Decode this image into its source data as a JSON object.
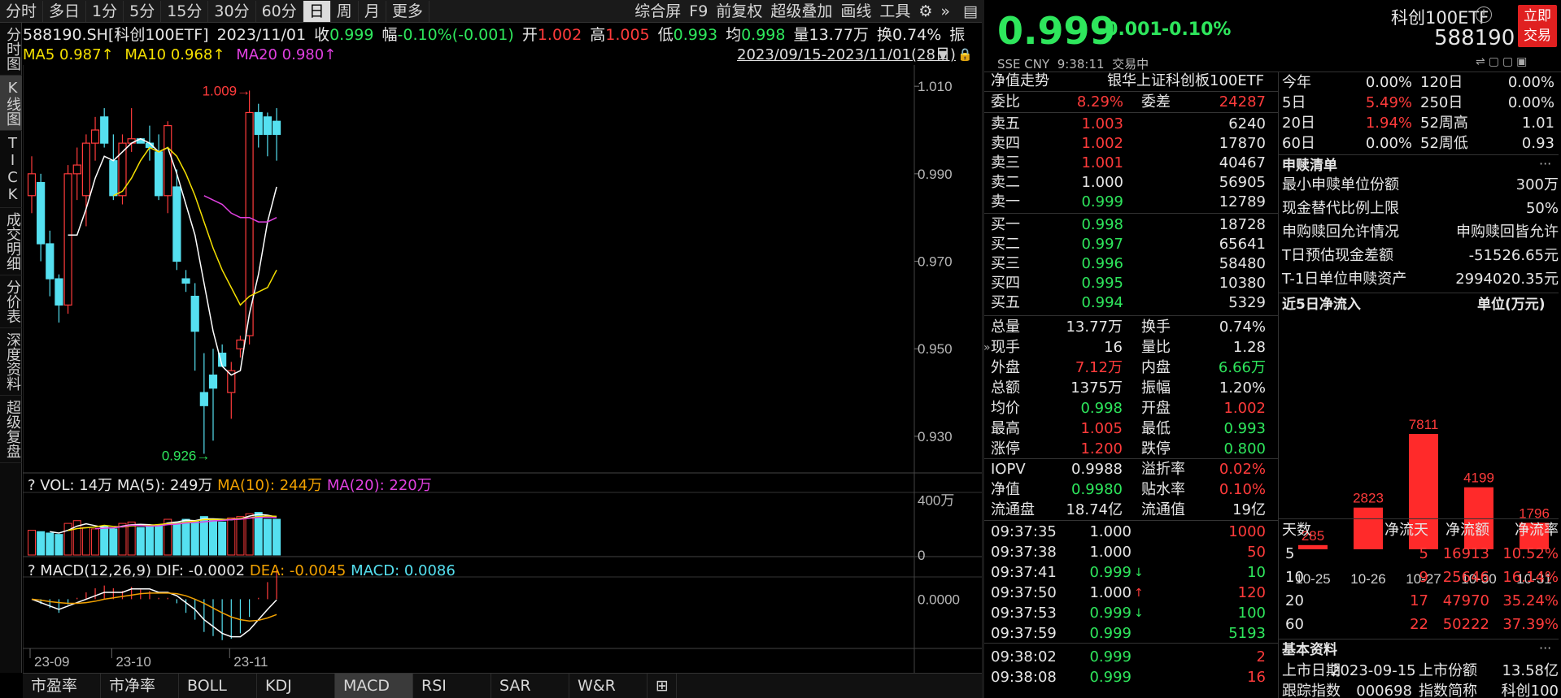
{
  "period_tabs": [
    "分时",
    "多日",
    "1分",
    "5分",
    "15分",
    "30分",
    "60分",
    "日",
    "周",
    "月",
    "更多"
  ],
  "active_period": "日",
  "top_right_menu": [
    "综合屏",
    "F9",
    "前复权",
    "超级叠加",
    "画线",
    "工具"
  ],
  "side_tabs": [
    "分时图",
    "K线图",
    "TICK",
    "成交明细",
    "分价表",
    "深度资料",
    "超级复盘"
  ],
  "info": {
    "code": "588190.SH[科创100ETF]",
    "date": "2023/11/01",
    "close_label": "收",
    "close": "0.999",
    "chg_label": "幅",
    "chg": "-0.10%(-0.001)",
    "open_label": "开",
    "open": "1.002",
    "high_label": "高",
    "high": "1.005",
    "low_label": "低",
    "low": "0.993",
    "avg_label": "均",
    "avg": "0.998",
    "vol_label": "量",
    "vol": "13.77万",
    "turn_label": "换",
    "turn": "0.74%",
    "amp_label": "振"
  },
  "ma_line": {
    "ma5": "MA5 0.987↑",
    "ma10": "MA10 0.968↑",
    "ma20": "MA20 0.980↑"
  },
  "range_text": "2023/09/15-2023/11/01(28日)",
  "price_axis": [
    "1.010",
    "0.990",
    "0.970",
    "0.950",
    "0.930"
  ],
  "high_mark": "1.009",
  "low_mark": "0.926",
  "vol_line": {
    "q": "?",
    "vol": "VOL: 14万",
    "ma5": "MA(5): 249万",
    "ma10": "MA(10): 244万",
    "ma20": "MA(20): 220万"
  },
  "vol_axis": [
    "400万",
    "0"
  ],
  "macd_line": {
    "q": "?",
    "name": "MACD(12,26,9)",
    "dif": "DIF: -0.0002",
    "dea": "DEA: -0.0045",
    "macd": "MACD: 0.0086"
  },
  "macd_axis": "0.0000",
  "date_axis": [
    "23-09",
    "23-10",
    "23-11"
  ],
  "bottom_tabs": [
    "市盈率",
    "市净率",
    "BOLL",
    "KDJ",
    "MACD",
    "RSI",
    "SAR",
    "W&R"
  ],
  "active_bottom": "MACD",
  "colors": {
    "up": "#ff3b3b",
    "down": "#2ee65c",
    "flat_candle": "#55e0f0",
    "ma5": "#ffffff",
    "ma10": "#f5e000",
    "ma20": "#e040e0"
  },
  "chart_data": {
    "type": "candlestick",
    "ylim": [
      0.922,
      1.013
    ],
    "candles": [
      {
        "o": 0.985,
        "h": 0.994,
        "l": 0.981,
        "c": 0.99
      },
      {
        "o": 0.988,
        "h": 0.99,
        "l": 0.97,
        "c": 0.974
      },
      {
        "o": 0.974,
        "h": 0.977,
        "l": 0.962,
        "c": 0.966
      },
      {
        "o": 0.966,
        "h": 0.967,
        "l": 0.956,
        "c": 0.96
      },
      {
        "o": 0.96,
        "h": 0.992,
        "l": 0.958,
        "c": 0.99
      },
      {
        "o": 0.99,
        "h": 0.996,
        "l": 0.984,
        "c": 0.992
      },
      {
        "o": 0.985,
        "h": 0.999,
        "l": 0.978,
        "c": 0.997
      },
      {
        "o": 0.997,
        "h": 1.003,
        "l": 0.993,
        "c": 1.0
      },
      {
        "o": 1.003,
        "h": 1.005,
        "l": 0.996,
        "c": 0.997
      },
      {
        "o": 0.993,
        "h": 0.999,
        "l": 0.984,
        "c": 0.985
      },
      {
        "o": 0.985,
        "h": 0.999,
        "l": 0.983,
        "c": 0.997
      },
      {
        "o": 0.997,
        "h": 1.005,
        "l": 0.995,
        "c": 0.998
      },
      {
        "o": 0.998,
        "h": 0.998,
        "l": 0.997,
        "c": 0.997
      },
      {
        "o": 0.997,
        "h": 1.001,
        "l": 0.993,
        "c": 0.996
      },
      {
        "o": 0.995,
        "h": 0.999,
        "l": 0.984,
        "c": 0.985
      },
      {
        "o": 0.985,
        "h": 1.002,
        "l": 0.981,
        "c": 1.001
      },
      {
        "o": 0.987,
        "h": 0.991,
        "l": 0.968,
        "c": 0.97
      },
      {
        "o": 0.966,
        "h": 0.968,
        "l": 0.963,
        "c": 0.965
      },
      {
        "o": 0.962,
        "h": 0.965,
        "l": 0.945,
        "c": 0.954
      },
      {
        "o": 0.94,
        "h": 0.949,
        "l": 0.926,
        "c": 0.937
      },
      {
        "o": 0.944,
        "h": 0.95,
        "l": 0.929,
        "c": 0.941
      },
      {
        "o": 0.949,
        "h": 0.951,
        "l": 0.946,
        "c": 0.946
      },
      {
        "o": 0.94,
        "h": 0.947,
        "l": 0.934,
        "c": 0.945
      },
      {
        "o": 0.95,
        "h": 0.953,
        "l": 0.948,
        "c": 0.952
      },
      {
        "o": 0.953,
        "h": 1.009,
        "l": 0.951,
        "c": 1.004
      },
      {
        "o": 1.004,
        "h": 1.006,
        "l": 0.996,
        "c": 0.999
      },
      {
        "o": 1.003,
        "h": 1.004,
        "l": 0.994,
        "c": 0.999
      },
      {
        "o": 1.002,
        "h": 1.005,
        "l": 0.993,
        "c": 0.999
      }
    ],
    "ma5": [
      null,
      null,
      null,
      null,
      0.976,
      0.976,
      0.982,
      0.989,
      0.994,
      0.993,
      0.995,
      0.997,
      0.998,
      0.997,
      0.995,
      0.996,
      0.99,
      0.983,
      0.976,
      0.965,
      0.954,
      0.946,
      0.944,
      0.945,
      0.958,
      0.967,
      0.979,
      0.987
    ],
    "ma10": [
      null,
      null,
      null,
      null,
      null,
      null,
      null,
      null,
      null,
      0.985,
      0.986,
      0.989,
      0.993,
      0.996,
      0.995,
      0.996,
      0.994,
      0.99,
      0.985,
      0.979,
      0.973,
      0.968,
      0.964,
      0.96,
      0.962,
      0.963,
      0.964,
      0.968
    ],
    "ma20": [
      null,
      null,
      null,
      null,
      null,
      null,
      null,
      null,
      null,
      null,
      null,
      null,
      null,
      null,
      null,
      null,
      null,
      null,
      null,
      0.985,
      0.984,
      0.983,
      0.981,
      0.98,
      0.98,
      0.979,
      0.979,
      0.98
    ],
    "volume": [
      180,
      170,
      160,
      150,
      230,
      250,
      200,
      190,
      210,
      190,
      230,
      240,
      200,
      220,
      220,
      260,
      240,
      260,
      250,
      280,
      260,
      240,
      270,
      280,
      300,
      310,
      260,
      260
    ],
    "volume_ylim": [
      0,
      420
    ],
    "macd_dif": [
      0,
      -0.001,
      -0.002,
      -0.003,
      -0.002,
      -0.001,
      0.0,
      0.001,
      0.002,
      0.002,
      0.002,
      0.003,
      0.003,
      0.003,
      0.002,
      0.002,
      0.001,
      -0.001,
      -0.003,
      -0.006,
      -0.008,
      -0.01,
      -0.011,
      -0.011,
      -0.009,
      -0.006,
      -0.003,
      -0.0002
    ],
    "macd_dea": [
      0,
      -0.0003,
      -0.0007,
      -0.001,
      -0.0012,
      -0.0012,
      -0.001,
      -0.0006,
      0.0,
      0.0004,
      0.0008,
      0.0012,
      0.0016,
      0.0018,
      0.0018,
      0.0018,
      0.0016,
      0.001,
      0.0,
      -0.0012,
      -0.0026,
      -0.004,
      -0.0052,
      -0.006,
      -0.0064,
      -0.0062,
      -0.0055,
      -0.0045
    ],
    "macd_ylim": [
      -0.013,
      0.012
    ]
  },
  "right": {
    "price": "0.999",
    "change": "-0.001",
    "change_pct": "-0.10%",
    "name": "科创100ETF",
    "code": "588190",
    "trade_btn": "立即交易",
    "market": "SSE CNY",
    "time": "9:38:11",
    "status": "交易中",
    "nav_trend": "净值走势",
    "index_name": "银华上证科创板100ETF",
    "weibi_label": "委比",
    "weibi": "8.29%",
    "weicha_label": "委差",
    "weicha": "24287",
    "asks": [
      [
        "卖五",
        "1.003",
        "6240",
        "red"
      ],
      [
        "卖四",
        "1.002",
        "17870",
        "red"
      ],
      [
        "卖三",
        "1.001",
        "40467",
        "red"
      ],
      [
        "卖二",
        "1.000",
        "56905",
        "white"
      ],
      [
        "卖一",
        "0.999",
        "12789",
        "green"
      ]
    ],
    "bids": [
      [
        "买一",
        "0.998",
        "18728",
        "green"
      ],
      [
        "买二",
        "0.997",
        "65641",
        "green"
      ],
      [
        "买三",
        "0.996",
        "58480",
        "green"
      ],
      [
        "买四",
        "0.995",
        "10380",
        "green"
      ],
      [
        "买五",
        "0.994",
        "5329",
        "green"
      ]
    ],
    "stats": [
      [
        "总量",
        "13.77万",
        "white",
        "换手",
        "0.74%",
        "white"
      ],
      [
        "现手",
        "16",
        "white",
        "量比",
        "1.28",
        "white"
      ],
      [
        "外盘",
        "7.12万",
        "red",
        "内盘",
        "6.66万",
        "green"
      ],
      [
        "总额",
        "1375万",
        "white",
        "振幅",
        "1.20%",
        "white"
      ],
      [
        "均价",
        "0.998",
        "green",
        "开盘",
        "1.002",
        "red"
      ],
      [
        "最高",
        "1.005",
        "red",
        "最低",
        "0.993",
        "green"
      ],
      [
        "涨停",
        "1.200",
        "red",
        "跌停",
        "0.800",
        "green"
      ]
    ],
    "iopv": [
      [
        "IOPV",
        "0.9988",
        "white",
        "溢折率",
        "0.02%",
        "red"
      ],
      [
        "净值",
        "0.9980",
        "green",
        "贴水率",
        "0.10%",
        "red"
      ],
      [
        "流通盘",
        "18.74亿",
        "white",
        "流通值",
        "19亿",
        "white"
      ]
    ],
    "ticks": [
      [
        "09:37:35",
        "1.000",
        "white",
        "",
        "1000",
        "red"
      ],
      [
        "09:37:38",
        "1.000",
        "white",
        "",
        "50",
        "red"
      ],
      [
        "09:37:41",
        "0.999",
        "green",
        "↓",
        "10",
        "green"
      ],
      [
        "09:37:50",
        "1.000",
        "white",
        "↑",
        "120",
        "red"
      ],
      [
        "09:37:53",
        "0.999",
        "green",
        "↓",
        "100",
        "green"
      ],
      [
        "09:37:59",
        "0.999",
        "green",
        "",
        "5193",
        "green"
      ],
      [
        "09:38:02",
        "0.999",
        "green",
        "",
        "2",
        "red"
      ],
      [
        "09:38:08",
        "0.999",
        "green",
        "",
        "16",
        "red"
      ]
    ],
    "perf": [
      [
        "今年",
        "0.00%",
        "white",
        "120日",
        "0.00%"
      ],
      [
        "5日",
        "5.49%",
        "red",
        "250日",
        "0.00%"
      ],
      [
        "20日",
        "1.94%",
        "red",
        "52周高",
        "1.01"
      ],
      [
        "60日",
        "0.00%",
        "white",
        "52周低",
        "0.93"
      ]
    ],
    "sg_title": "申赎清单",
    "sg": [
      [
        "最小申赎单位份额",
        "300万"
      ],
      [
        "现金替代比例上限",
        "50%"
      ],
      [
        "申购赎回允许情况",
        "申购赎回皆允许"
      ],
      [
        "T日预估现金差额",
        "-51526.65元"
      ],
      [
        "T-1日单位申赎资产",
        "2994020.35元"
      ]
    ],
    "flow_title": "近5日净流入",
    "flow_unit": "单位(万元)",
    "flow_data": {
      "type": "bar",
      "categories": [
        "10-25",
        "10-26",
        "10-27",
        "10-30",
        "10-31"
      ],
      "values": [
        285,
        2823,
        7811,
        4199,
        1796
      ]
    },
    "netflow_header": [
      "天数",
      "净流天",
      "净流额",
      "净流率"
    ],
    "netflow": [
      [
        "5",
        "5",
        "16913",
        "10.52%"
      ],
      [
        "10",
        "9",
        "25646",
        "16.14%"
      ],
      [
        "20",
        "17",
        "47970",
        "35.24%"
      ],
      [
        "60",
        "22",
        "50222",
        "37.39%"
      ]
    ],
    "basic_title": "基本资料",
    "basic": [
      [
        "上市日期",
        "2023-09-15",
        "上市份额",
        "13.58亿"
      ],
      [
        "跟踪指数",
        "000698",
        "指数简称",
        "科创100"
      ]
    ]
  }
}
